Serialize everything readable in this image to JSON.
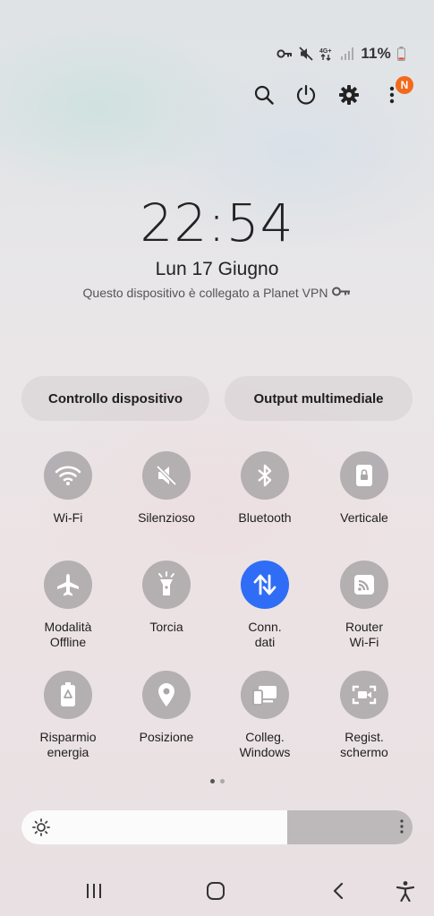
{
  "status_bar": {
    "icons": [
      "vpn-key-icon",
      "mute-icon",
      "4g-data-icon",
      "signal-icon"
    ],
    "network_label": "4G+",
    "battery": "11%"
  },
  "top_actions": {
    "icons": [
      "search-icon",
      "power-icon",
      "settings-icon",
      "more-options-icon"
    ],
    "badge": "N"
  },
  "clock": {
    "time": "22:54",
    "date": "Lun 17 Giugno",
    "vpn_notice": "Questo dispositivo è collegato a Planet VPN"
  },
  "buttons": {
    "device_control": "Controllo dispositivo",
    "media_output": "Output multimediale"
  },
  "tiles": [
    {
      "label": "Wi-Fi",
      "icon": "wifi-icon",
      "active": false
    },
    {
      "label": "Silenzioso",
      "icon": "mute-icon",
      "active": false
    },
    {
      "label": "Bluetooth",
      "icon": "bluetooth-icon",
      "active": false
    },
    {
      "label": "Verticale",
      "icon": "portrait-lock-icon",
      "active": false
    },
    {
      "label": "Modalità\nOffline",
      "icon": "airplane-icon",
      "active": false
    },
    {
      "label": "Torcia",
      "icon": "flashlight-icon",
      "active": false
    },
    {
      "label": "Conn.\ndati",
      "icon": "mobile-data-icon",
      "active": true
    },
    {
      "label": "Router\nWi-Fi",
      "icon": "hotspot-icon",
      "active": false
    },
    {
      "label": "Risparmio\nenergia",
      "icon": "battery-saver-icon",
      "active": false
    },
    {
      "label": "Posizione",
      "icon": "location-icon",
      "active": false
    },
    {
      "label": "Colleg.\nWindows",
      "icon": "link-windows-icon",
      "active": false
    },
    {
      "label": "Regist.\nschermo",
      "icon": "screen-record-icon",
      "active": false
    }
  ],
  "pager": {
    "pages": 2,
    "current": 1
  },
  "brightness": {
    "level": 0.68
  },
  "nav_bar": {
    "icons": [
      "recent-apps-icon",
      "home-icon",
      "back-icon",
      "accessibility-icon"
    ]
  },
  "colors": {
    "accent_active": "#2f6df6",
    "tile_inactive": "#aaa6a8",
    "badge": "#f26a1b"
  }
}
